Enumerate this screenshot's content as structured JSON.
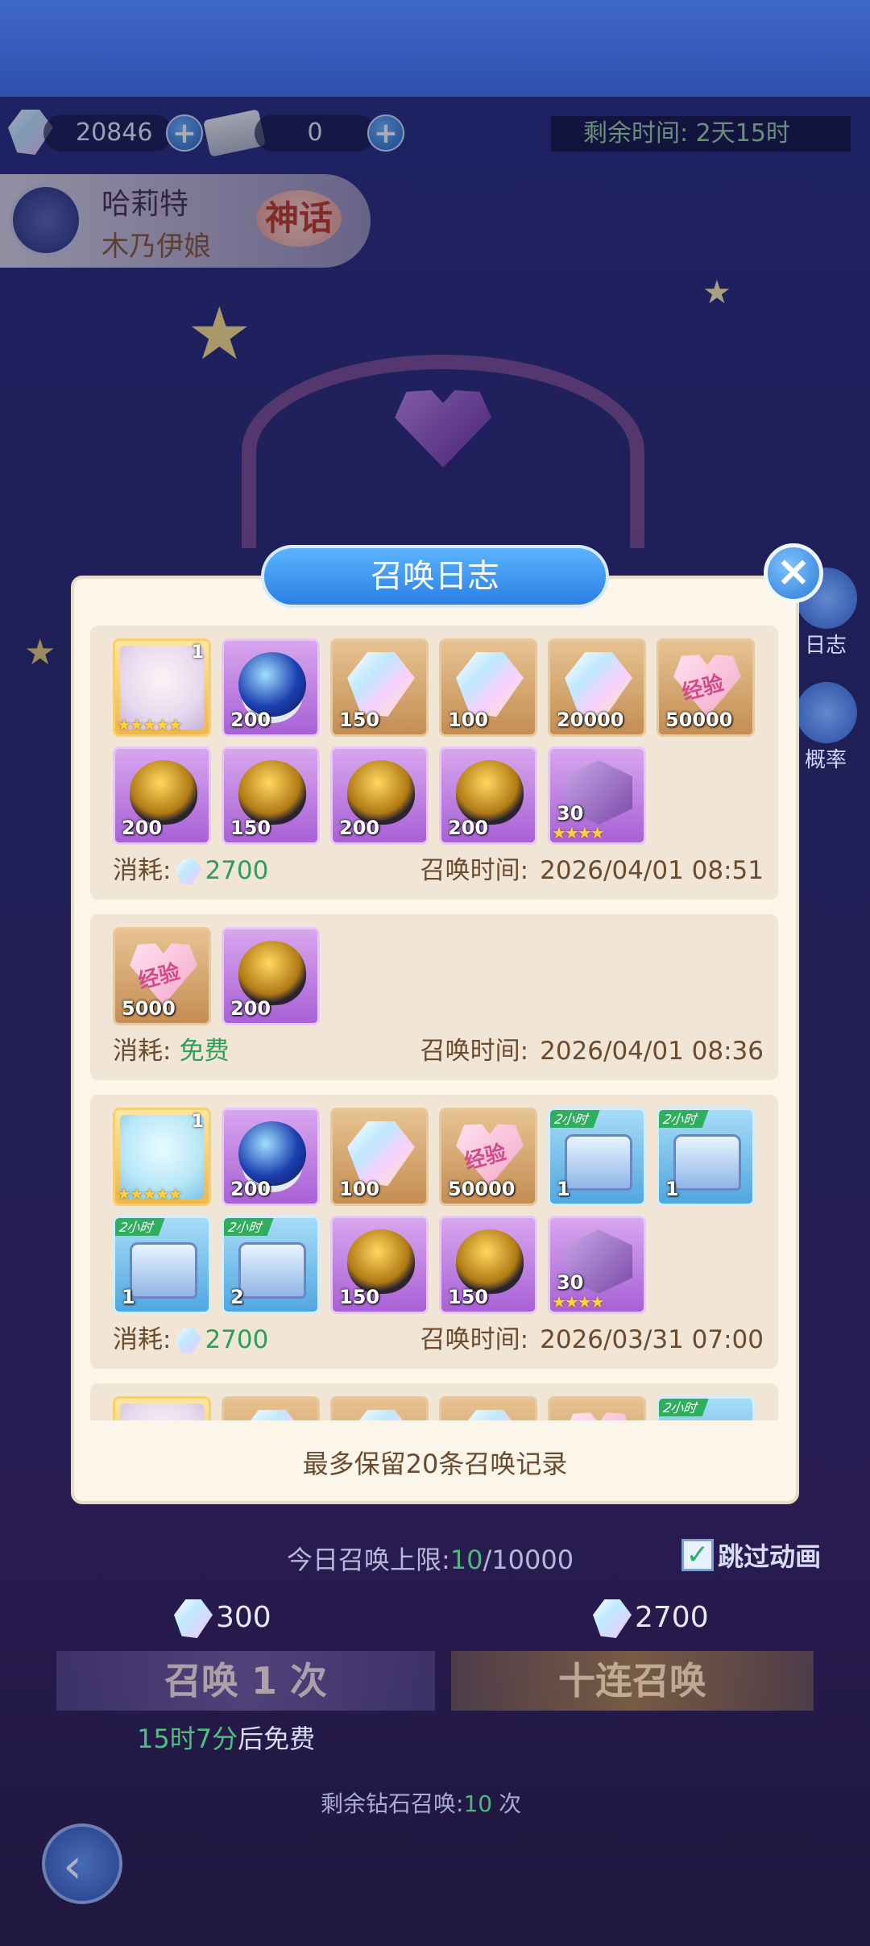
{
  "top": {
    "gems": "20846",
    "tickets": "0",
    "remaining_time": "剩余时间: 2天15时"
  },
  "hero_banner": {
    "name": "哈莉特",
    "subtitle": "木乃伊娘",
    "rarity": "神话"
  },
  "side": {
    "log_label": "日志",
    "rate_label": "概率"
  },
  "modal": {
    "title": "召唤日志",
    "footer": "最多保留20条召唤记录",
    "cost_label": "消耗:",
    "time_label": "召唤时间:",
    "records": [
      {
        "cost": "2700",
        "cost_free": false,
        "time": "2026/04/01 08:51",
        "items": [
          {
            "kind": "hero",
            "art": "face",
            "bg": "hero",
            "level": "1",
            "stars": "★★★★★"
          },
          {
            "kind": "item",
            "art": "orb",
            "bg": "purple",
            "qty": "200"
          },
          {
            "kind": "item",
            "art": "crystal",
            "bg": "gold",
            "qty": "150"
          },
          {
            "kind": "item",
            "art": "crystal",
            "bg": "gold",
            "qty": "100"
          },
          {
            "kind": "item",
            "art": "crystal",
            "bg": "gold",
            "qty": "20000"
          },
          {
            "kind": "item",
            "art": "heart",
            "bg": "gold",
            "qty": "50000",
            "label": "经验"
          },
          {
            "kind": "item",
            "art": "egg",
            "bg": "purple",
            "qty": "200"
          },
          {
            "kind": "item",
            "art": "egg",
            "bg": "purple",
            "qty": "150"
          },
          {
            "kind": "item",
            "art": "egg",
            "bg": "purple",
            "qty": "200"
          },
          {
            "kind": "item",
            "art": "egg",
            "bg": "purple",
            "qty": "200"
          },
          {
            "kind": "item",
            "art": "cube",
            "bg": "purple",
            "qty": "30",
            "stars": "★★★★"
          }
        ]
      },
      {
        "cost": "免费",
        "cost_free": true,
        "time": "2026/04/01 08:36",
        "items": [
          {
            "kind": "item",
            "art": "heart",
            "bg": "gold",
            "qty": "5000",
            "label": "经验"
          },
          {
            "kind": "item",
            "art": "egg",
            "bg": "purple",
            "qty": "200"
          }
        ]
      },
      {
        "cost": "2700",
        "cost_free": false,
        "time": "2026/03/31 07:00",
        "items": [
          {
            "kind": "hero",
            "art": "face2",
            "bg": "hero",
            "level": "1",
            "stars": "★★★★★"
          },
          {
            "kind": "item",
            "art": "orb",
            "bg": "purple",
            "qty": "200"
          },
          {
            "kind": "item",
            "art": "crystal",
            "bg": "gold",
            "qty": "100"
          },
          {
            "kind": "item",
            "art": "heart",
            "bg": "gold",
            "qty": "50000",
            "label": "经验"
          },
          {
            "kind": "item",
            "art": "chest",
            "bg": "blue",
            "qty": "1",
            "tag": "2小时"
          },
          {
            "kind": "item",
            "art": "chest",
            "bg": "blue",
            "qty": "1",
            "tag": "2小时"
          },
          {
            "kind": "item",
            "art": "chest",
            "bg": "blue",
            "qty": "1",
            "tag": "2小时"
          },
          {
            "kind": "item",
            "art": "chest",
            "bg": "blue",
            "qty": "2",
            "tag": "2小时"
          },
          {
            "kind": "item",
            "art": "egg",
            "bg": "purple",
            "qty": "150"
          },
          {
            "kind": "item",
            "art": "egg",
            "bg": "purple",
            "qty": "150"
          },
          {
            "kind": "item",
            "art": "cube",
            "bg": "purple",
            "qty": "30",
            "stars": "★★★★"
          }
        ]
      },
      {
        "cost": "",
        "cost_free": false,
        "time": "",
        "items": [
          {
            "kind": "hero",
            "art": "face",
            "bg": "hero"
          },
          {
            "kind": "item",
            "art": "crystal",
            "bg": "gold"
          },
          {
            "kind": "item",
            "art": "crystal",
            "bg": "gold"
          },
          {
            "kind": "item",
            "art": "crystal",
            "bg": "gold"
          },
          {
            "kind": "item",
            "art": "heart",
            "bg": "gold"
          },
          {
            "kind": "item",
            "art": "chest",
            "bg": "blue",
            "tag": "2小时"
          }
        ]
      }
    ]
  },
  "bottom": {
    "daily_limit_label": "今日召唤上限:",
    "daily_limit_current": "10",
    "daily_limit_max": "/10000",
    "skip_anim": "跳过动画",
    "single_cost": "300",
    "ten_cost": "2700",
    "single_btn": "召唤 1 次",
    "ten_btn": "十连召唤",
    "free_timer": "15时7分",
    "free_suffix": "后免费",
    "remaining_label": "剩余钻石召唤:",
    "remaining_count": "10",
    "remaining_unit": "次"
  }
}
